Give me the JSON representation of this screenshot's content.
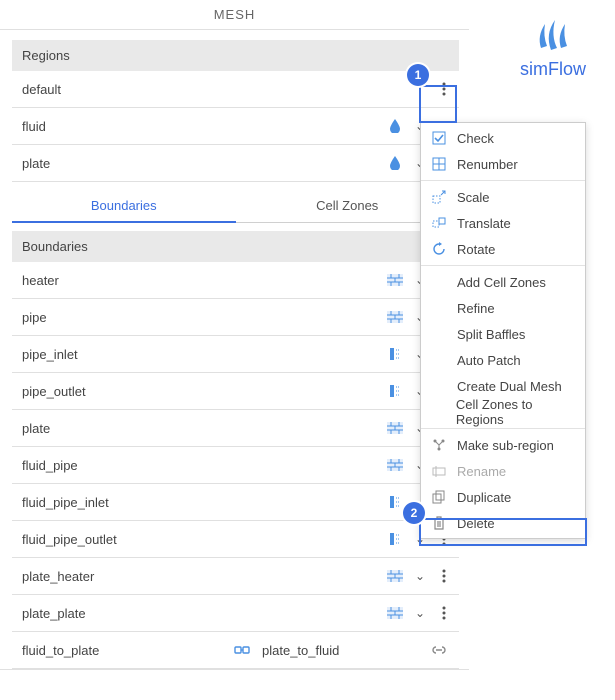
{
  "header": {
    "title": "MESH"
  },
  "logo": {
    "text": "simFlow"
  },
  "regions": {
    "heading": "Regions",
    "items": [
      {
        "name": "default",
        "hasDrop": false,
        "icon": null,
        "more": true
      },
      {
        "name": "fluid",
        "hasDrop": false,
        "icon": "drop",
        "more": false,
        "chevron": true
      },
      {
        "name": "plate",
        "hasDrop": false,
        "icon": "drop",
        "more": false,
        "chevron": true
      }
    ]
  },
  "tabs": [
    {
      "label": "Boundaries",
      "active": true
    },
    {
      "label": "Cell Zones",
      "active": false
    }
  ],
  "boundaries": {
    "heading": "Boundaries",
    "items": [
      {
        "name": "heater",
        "icon": "wall",
        "more": false
      },
      {
        "name": "pipe",
        "icon": "wall",
        "more": false
      },
      {
        "name": "pipe_inlet",
        "icon": "inlet",
        "more": false
      },
      {
        "name": "pipe_outlet",
        "icon": "inlet",
        "more": false
      },
      {
        "name": "plate",
        "icon": "wall",
        "more": false
      },
      {
        "name": "fluid_pipe",
        "icon": "wall",
        "more": false
      },
      {
        "name": "fluid_pipe_inlet",
        "icon": "inlet",
        "more": true
      },
      {
        "name": "fluid_pipe_outlet",
        "icon": "inlet",
        "more": true
      },
      {
        "name": "plate_heater",
        "icon": "wall",
        "more": true
      },
      {
        "name": "plate_plate",
        "icon": "wall",
        "more": true
      }
    ],
    "link": {
      "left": "fluid_to_plate",
      "right": "plate_to_fluid"
    }
  },
  "callouts": {
    "one": "1",
    "two": "2"
  },
  "menu": {
    "groups": [
      [
        {
          "label": "Check",
          "icon": "check"
        },
        {
          "label": "Renumber",
          "icon": "renumber"
        }
      ],
      [
        {
          "label": "Scale",
          "icon": "scale"
        },
        {
          "label": "Translate",
          "icon": "translate"
        },
        {
          "label": "Rotate",
          "icon": "rotate"
        }
      ],
      [
        {
          "label": "Add Cell Zones",
          "icon": null
        },
        {
          "label": "Refine",
          "icon": null
        },
        {
          "label": "Split Baffles",
          "icon": null
        },
        {
          "label": "Auto Patch",
          "icon": null
        },
        {
          "label": "Create Dual Mesh",
          "icon": null
        },
        {
          "label": "Cell Zones to Regions",
          "icon": null
        }
      ],
      [
        {
          "label": "Make sub-region",
          "icon": "subregion"
        },
        {
          "label": "Rename",
          "icon": "rename",
          "disabled": true
        },
        {
          "label": "Duplicate",
          "icon": "duplicate"
        },
        {
          "label": "Delete",
          "icon": "delete"
        }
      ]
    ]
  }
}
